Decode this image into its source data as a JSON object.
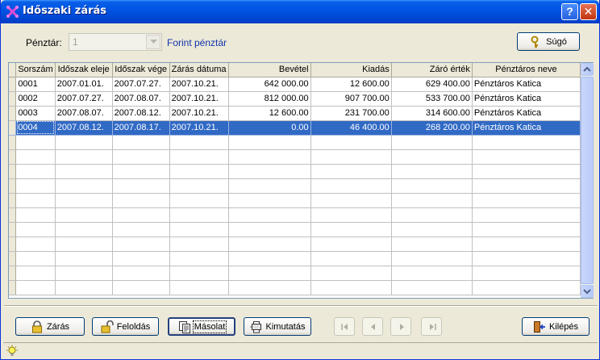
{
  "window": {
    "title": "Időszaki zárás",
    "help_glyph": "?",
    "close_glyph": "✕"
  },
  "header": {
    "penztar_label": "Pénztár:",
    "penztar_value": "1",
    "penztar_name": "Forint pénztár",
    "help_button": "Súgó"
  },
  "table": {
    "columns": [
      "Sorszám",
      "Időszak eleje",
      "Időszak vége",
      "Zárás dátuma",
      "Bevétel",
      "Kiadás",
      "Záró érték",
      "Pénztáros neve"
    ],
    "rows": [
      [
        "0001",
        "2007.01.01.",
        "2007.07.27.",
        "2007.10.21.",
        "642 000.00",
        "12 600.00",
        "629 400.00",
        "Pénztáros Katica"
      ],
      [
        "0002",
        "2007.07.27.",
        "2007.08.07.",
        "2007.10.21.",
        "812 000.00",
        "907 700.00",
        "533 700.00",
        "Pénztáros Katica"
      ],
      [
        "0003",
        "2007.08.07.",
        "2007.08.12.",
        "2007.10.21.",
        "12 600.00",
        "231 700.00",
        "314 600.00",
        "Pénztáros Katica"
      ],
      [
        "0004",
        "2007.08.12.",
        "2007.08.17.",
        "2007.10.21.",
        "0.00",
        "46 400.00",
        "268 200.00",
        "Pénztáros Katica"
      ]
    ],
    "selected_row": 3
  },
  "footer": {
    "zaras_button": "Zárás",
    "feloldas_button": "Feloldás",
    "masolat_button": "Másolat",
    "kimutatas_button": "Kimutatás",
    "kilepes_button": "Kilépés"
  },
  "colors": {
    "titlebar": "#0055E5",
    "selection": "#316AC5",
    "link_text": "#1133AA",
    "window_bg": "#ECE9D8"
  },
  "icons": {
    "title": "app-x-icon",
    "help": "key-icon",
    "zaras": "padlock-closed-icon",
    "feloldas": "padlock-open-icon",
    "masolat": "copy-pages-icon",
    "kimutatas": "report-icon",
    "kilepes": "exit-door-icon",
    "status": "lightbulb-icon"
  }
}
